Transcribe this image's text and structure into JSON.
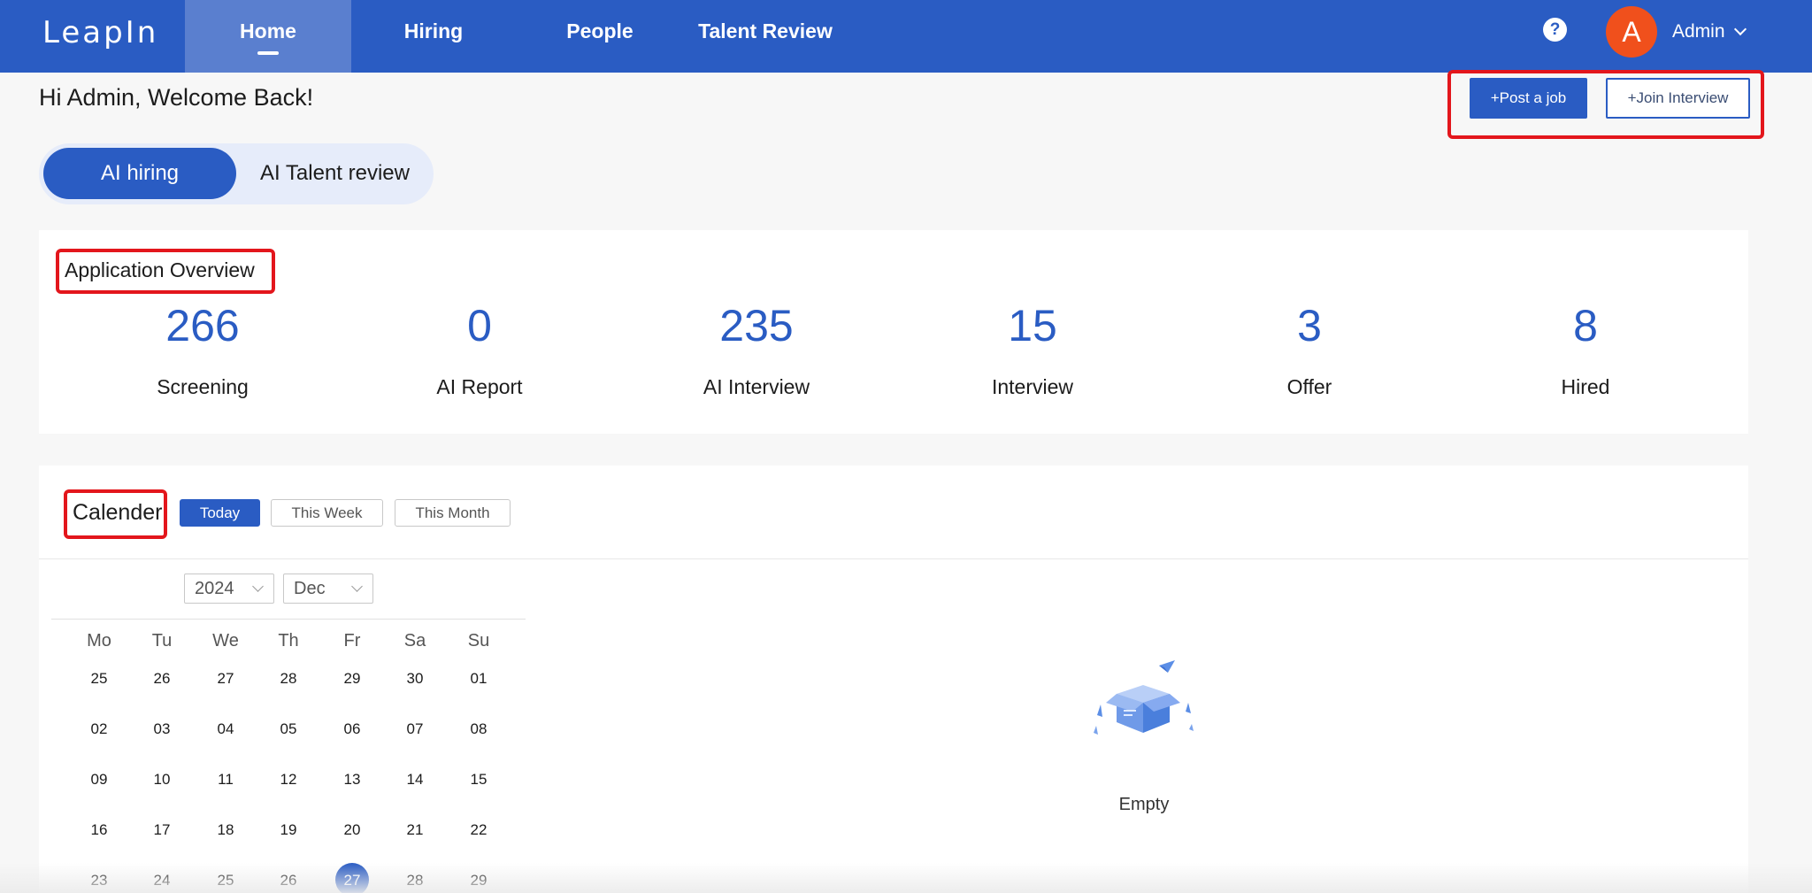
{
  "app": {
    "logo": "LeapIn"
  },
  "nav": {
    "home": "Home",
    "hiring": "Hiring",
    "people": "People",
    "talent_review": "Talent Review",
    "help_glyph": "?",
    "avatar_initial": "A",
    "user_name": "Admin"
  },
  "header": {
    "welcome": "Hi Admin, Welcome Back!",
    "post_job": "+Post a job",
    "join_interview": "+Join Interview"
  },
  "mode_toggle": {
    "active": "AI hiring",
    "inactive": "AI Talent review"
  },
  "overview": {
    "title": "Application Overview",
    "stats": [
      {
        "value": "266",
        "label": "Screening"
      },
      {
        "value": "0",
        "label": "AI Report"
      },
      {
        "value": "235",
        "label": "AI Interview"
      },
      {
        "value": "15",
        "label": "Interview"
      },
      {
        "value": "3",
        "label": "Offer"
      },
      {
        "value": "8",
        "label": "Hired"
      }
    ]
  },
  "calendar": {
    "title": "Calender",
    "ranges": {
      "today": "Today",
      "week": "This Week",
      "month": "This Month"
    },
    "year": "2024",
    "month": "Dec",
    "weekdays": [
      "Mo",
      "Tu",
      "We",
      "Th",
      "Fr",
      "Sa",
      "Su"
    ],
    "weeks": [
      [
        "25",
        "26",
        "27",
        "28",
        "29",
        "30",
        "01"
      ],
      [
        "02",
        "03",
        "04",
        "05",
        "06",
        "07",
        "08"
      ],
      [
        "09",
        "10",
        "11",
        "12",
        "13",
        "14",
        "15"
      ],
      [
        "16",
        "17",
        "18",
        "19",
        "20",
        "21",
        "22"
      ],
      [
        "23",
        "24",
        "25",
        "26",
        "27",
        "28",
        "29"
      ]
    ],
    "selected_day": "27"
  },
  "empty_state": {
    "text": "Empty",
    "icon": "empty-box-icon"
  },
  "colors": {
    "primary": "#2a5cc3",
    "avatar": "#f0501c",
    "highlight": "#e3161c"
  }
}
